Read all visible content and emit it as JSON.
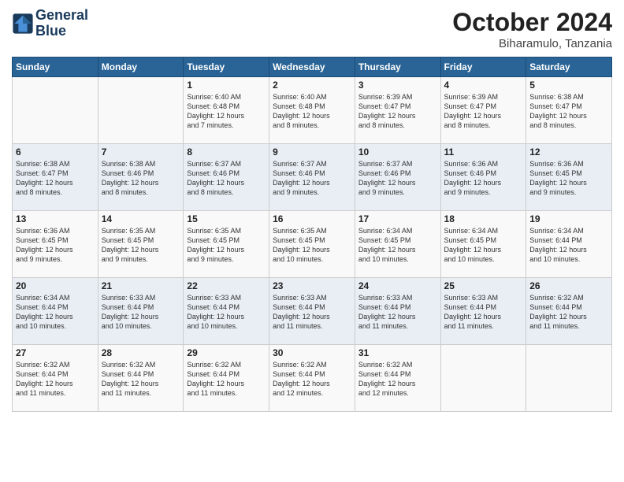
{
  "header": {
    "logo_line1": "General",
    "logo_line2": "Blue",
    "month": "October 2024",
    "location": "Biharamulo, Tanzania"
  },
  "days_of_week": [
    "Sunday",
    "Monday",
    "Tuesday",
    "Wednesday",
    "Thursday",
    "Friday",
    "Saturday"
  ],
  "weeks": [
    [
      {
        "day": "",
        "content": ""
      },
      {
        "day": "",
        "content": ""
      },
      {
        "day": "1",
        "content": "Sunrise: 6:40 AM\nSunset: 6:48 PM\nDaylight: 12 hours\nand 7 minutes."
      },
      {
        "day": "2",
        "content": "Sunrise: 6:40 AM\nSunset: 6:48 PM\nDaylight: 12 hours\nand 8 minutes."
      },
      {
        "day": "3",
        "content": "Sunrise: 6:39 AM\nSunset: 6:47 PM\nDaylight: 12 hours\nand 8 minutes."
      },
      {
        "day": "4",
        "content": "Sunrise: 6:39 AM\nSunset: 6:47 PM\nDaylight: 12 hours\nand 8 minutes."
      },
      {
        "day": "5",
        "content": "Sunrise: 6:38 AM\nSunset: 6:47 PM\nDaylight: 12 hours\nand 8 minutes."
      }
    ],
    [
      {
        "day": "6",
        "content": "Sunrise: 6:38 AM\nSunset: 6:47 PM\nDaylight: 12 hours\nand 8 minutes."
      },
      {
        "day": "7",
        "content": "Sunrise: 6:38 AM\nSunset: 6:46 PM\nDaylight: 12 hours\nand 8 minutes."
      },
      {
        "day": "8",
        "content": "Sunrise: 6:37 AM\nSunset: 6:46 PM\nDaylight: 12 hours\nand 8 minutes."
      },
      {
        "day": "9",
        "content": "Sunrise: 6:37 AM\nSunset: 6:46 PM\nDaylight: 12 hours\nand 9 minutes."
      },
      {
        "day": "10",
        "content": "Sunrise: 6:37 AM\nSunset: 6:46 PM\nDaylight: 12 hours\nand 9 minutes."
      },
      {
        "day": "11",
        "content": "Sunrise: 6:36 AM\nSunset: 6:46 PM\nDaylight: 12 hours\nand 9 minutes."
      },
      {
        "day": "12",
        "content": "Sunrise: 6:36 AM\nSunset: 6:45 PM\nDaylight: 12 hours\nand 9 minutes."
      }
    ],
    [
      {
        "day": "13",
        "content": "Sunrise: 6:36 AM\nSunset: 6:45 PM\nDaylight: 12 hours\nand 9 minutes."
      },
      {
        "day": "14",
        "content": "Sunrise: 6:35 AM\nSunset: 6:45 PM\nDaylight: 12 hours\nand 9 minutes."
      },
      {
        "day": "15",
        "content": "Sunrise: 6:35 AM\nSunset: 6:45 PM\nDaylight: 12 hours\nand 9 minutes."
      },
      {
        "day": "16",
        "content": "Sunrise: 6:35 AM\nSunset: 6:45 PM\nDaylight: 12 hours\nand 10 minutes."
      },
      {
        "day": "17",
        "content": "Sunrise: 6:34 AM\nSunset: 6:45 PM\nDaylight: 12 hours\nand 10 minutes."
      },
      {
        "day": "18",
        "content": "Sunrise: 6:34 AM\nSunset: 6:45 PM\nDaylight: 12 hours\nand 10 minutes."
      },
      {
        "day": "19",
        "content": "Sunrise: 6:34 AM\nSunset: 6:44 PM\nDaylight: 12 hours\nand 10 minutes."
      }
    ],
    [
      {
        "day": "20",
        "content": "Sunrise: 6:34 AM\nSunset: 6:44 PM\nDaylight: 12 hours\nand 10 minutes."
      },
      {
        "day": "21",
        "content": "Sunrise: 6:33 AM\nSunset: 6:44 PM\nDaylight: 12 hours\nand 10 minutes."
      },
      {
        "day": "22",
        "content": "Sunrise: 6:33 AM\nSunset: 6:44 PM\nDaylight: 12 hours\nand 10 minutes."
      },
      {
        "day": "23",
        "content": "Sunrise: 6:33 AM\nSunset: 6:44 PM\nDaylight: 12 hours\nand 11 minutes."
      },
      {
        "day": "24",
        "content": "Sunrise: 6:33 AM\nSunset: 6:44 PM\nDaylight: 12 hours\nand 11 minutes."
      },
      {
        "day": "25",
        "content": "Sunrise: 6:33 AM\nSunset: 6:44 PM\nDaylight: 12 hours\nand 11 minutes."
      },
      {
        "day": "26",
        "content": "Sunrise: 6:32 AM\nSunset: 6:44 PM\nDaylight: 12 hours\nand 11 minutes."
      }
    ],
    [
      {
        "day": "27",
        "content": "Sunrise: 6:32 AM\nSunset: 6:44 PM\nDaylight: 12 hours\nand 11 minutes."
      },
      {
        "day": "28",
        "content": "Sunrise: 6:32 AM\nSunset: 6:44 PM\nDaylight: 12 hours\nand 11 minutes."
      },
      {
        "day": "29",
        "content": "Sunrise: 6:32 AM\nSunset: 6:44 PM\nDaylight: 12 hours\nand 11 minutes."
      },
      {
        "day": "30",
        "content": "Sunrise: 6:32 AM\nSunset: 6:44 PM\nDaylight: 12 hours\nand 12 minutes."
      },
      {
        "day": "31",
        "content": "Sunrise: 6:32 AM\nSunset: 6:44 PM\nDaylight: 12 hours\nand 12 minutes."
      },
      {
        "day": "",
        "content": ""
      },
      {
        "day": "",
        "content": ""
      }
    ]
  ]
}
